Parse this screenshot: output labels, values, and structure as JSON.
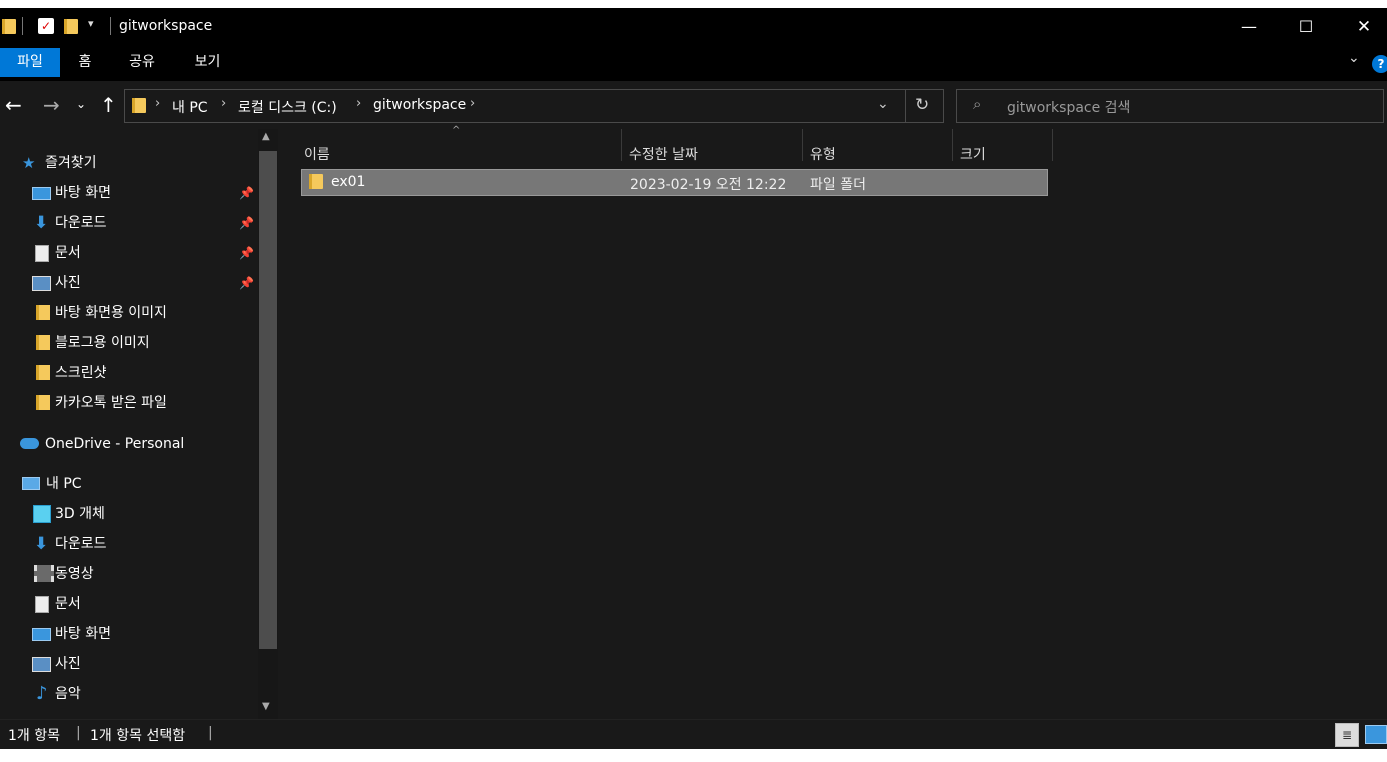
{
  "window": {
    "title": "gitworkspace",
    "controls": {
      "minimize": "—",
      "maximize": "☐",
      "close": "✕"
    }
  },
  "ribbon": {
    "tabs": [
      {
        "label": "파일",
        "active": true
      },
      {
        "label": "홈",
        "active": false
      },
      {
        "label": "공유",
        "active": false
      },
      {
        "label": "보기",
        "active": false
      }
    ]
  },
  "address": {
    "crumbs": [
      "내 PC",
      "로컬 디스크 (C:)",
      "gitworkspace"
    ],
    "search_placeholder": "gitworkspace 검색"
  },
  "sidebar": {
    "quick_access": "즐겨찾기",
    "quick_items": [
      {
        "label": "바탕 화면",
        "icon": "desktop-icon",
        "pinned": true
      },
      {
        "label": "다운로드",
        "icon": "download-icon",
        "pinned": true
      },
      {
        "label": "문서",
        "icon": "document-icon",
        "pinned": true
      },
      {
        "label": "사진",
        "icon": "picture-icon",
        "pinned": true
      },
      {
        "label": "바탕 화면용 이미지",
        "icon": "folder-icon",
        "pinned": false
      },
      {
        "label": "블로그용 이미지",
        "icon": "folder-icon",
        "pinned": false
      },
      {
        "label": "스크린샷",
        "icon": "folder-icon",
        "pinned": false
      },
      {
        "label": "카카오톡 받은 파일",
        "icon": "folder-icon",
        "pinned": false
      }
    ],
    "onedrive": "OneDrive - Personal",
    "this_pc": "내 PC",
    "pc_items": [
      {
        "label": "3D 개체",
        "icon": "3d-objects-icon"
      },
      {
        "label": "다운로드",
        "icon": "download-icon"
      },
      {
        "label": "동영상",
        "icon": "video-icon"
      },
      {
        "label": "문서",
        "icon": "document-icon"
      },
      {
        "label": "바탕 화면",
        "icon": "desktop-icon"
      },
      {
        "label": "사진",
        "icon": "picture-icon"
      },
      {
        "label": "음악",
        "icon": "music-icon"
      }
    ]
  },
  "columns": {
    "name": "이름",
    "date": "수정한 날짜",
    "type": "유형",
    "size": "크기"
  },
  "files": [
    {
      "name": "ex01",
      "date": "2023-02-19 오전 12:22",
      "type": "파일 폴더",
      "size": "",
      "selected": true
    }
  ],
  "status": {
    "count": "1개 항목",
    "selected": "1개 항목 선택함"
  },
  "colors": {
    "accent": "#0078d7",
    "background": "#191919",
    "selection": "#777777"
  }
}
